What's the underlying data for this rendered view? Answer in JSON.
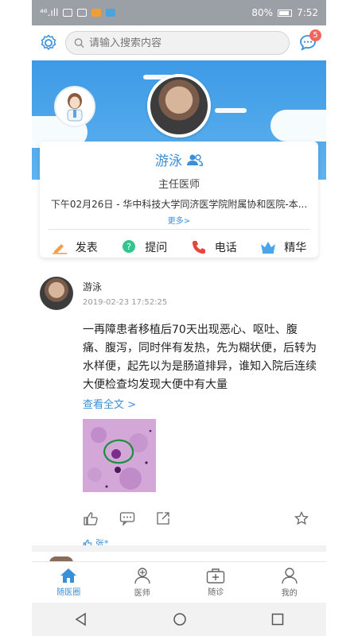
{
  "status_bar": {
    "signal_text": "⁴⁶.ıll",
    "battery_percent": "80%",
    "time": "7:52"
  },
  "header": {
    "search_placeholder": "请输入搜索内容",
    "message_badge": "5"
  },
  "doctor": {
    "name": "游泳",
    "title": "主任医师",
    "description": "下午02月26日 - 华中科技大学同济医学院附属协和医院-本...",
    "more_label": "更多>"
  },
  "actions": [
    {
      "label": "发表",
      "icon": "pencil-icon"
    },
    {
      "label": "提问",
      "icon": "question-bubble-icon"
    },
    {
      "label": "电话",
      "icon": "phone-icon"
    },
    {
      "label": "精华",
      "icon": "crown-icon"
    }
  ],
  "post": {
    "author": "游泳",
    "time": "2019-02-23 17:52:25",
    "body": "一再障患者移植后70天出现恶心、呕吐、腹痛、腹泻，同时伴有发热，先为糊状便，后转为水样便，起先以为是肠道排异，谁知入院后连续大便检查均发现大便中有大量",
    "read_all": "查看全文 >",
    "likes": "张*"
  },
  "tabs": [
    {
      "label": "随医圈",
      "icon": "home-icon",
      "active": true
    },
    {
      "label": "医师",
      "icon": "doctor-icon",
      "active": false
    },
    {
      "label": "随诊",
      "icon": "medical-kit-icon",
      "active": false
    },
    {
      "label": "我的",
      "icon": "user-icon",
      "active": false
    }
  ],
  "colors": {
    "accent": "#3a8fd9",
    "banner": "#4aa6ec",
    "badge": "#f0665a"
  }
}
